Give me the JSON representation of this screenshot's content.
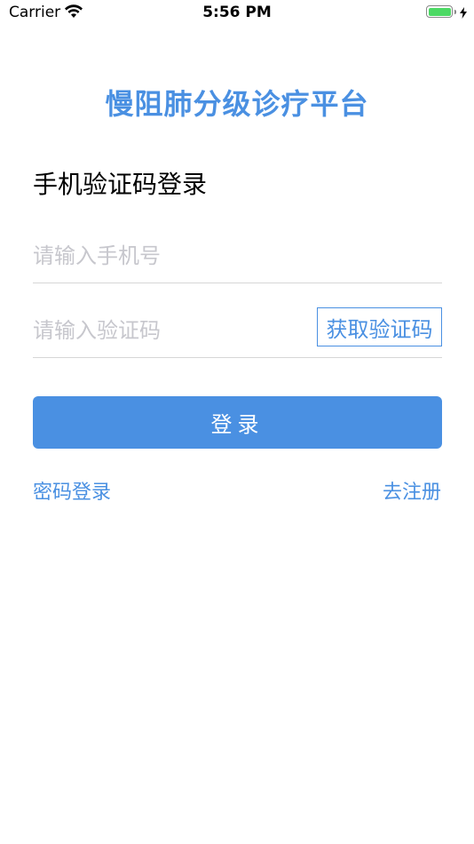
{
  "status_bar": {
    "carrier": "Carrier",
    "time": "5:56 PM",
    "battery_level": 1.0,
    "icons": [
      "wifi-icon",
      "battery-icon",
      "charging-bolt-icon"
    ]
  },
  "app": {
    "title": "慢阻肺分级诊疗平台",
    "accent_color": "#4a90e2"
  },
  "login": {
    "section_title": "手机验证码登录",
    "phone_placeholder": "请输入手机号",
    "code_placeholder": "请输入验证码",
    "get_code_label": "获取验证码",
    "submit_label": "登录",
    "password_login_link": "密码登录",
    "register_link": "去注册"
  }
}
